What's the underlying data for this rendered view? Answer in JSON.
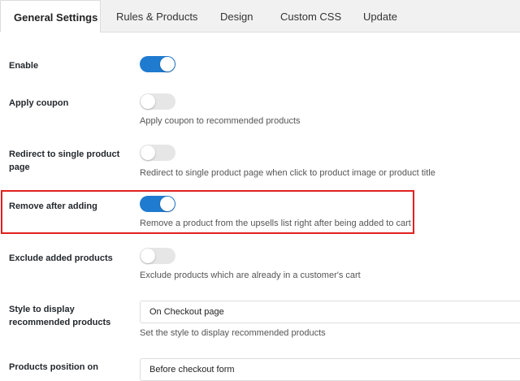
{
  "tabs": [
    {
      "label": "General Settings",
      "active": true
    },
    {
      "label": "Rules & Products",
      "active": false
    },
    {
      "label": "Design",
      "active": false
    },
    {
      "label": "Custom CSS",
      "active": false
    },
    {
      "label": "Update",
      "active": false
    }
  ],
  "settings": {
    "enable": {
      "label": "Enable",
      "checked": true
    },
    "apply_coupon": {
      "label": "Apply coupon",
      "checked": false,
      "description": "Apply coupon to recommended products"
    },
    "redirect": {
      "label_line1": "Redirect to single product",
      "label_line2": "page",
      "checked": false,
      "description": "Redirect to single product page when click to product image or product title"
    },
    "remove_after_adding": {
      "label": "Remove after adding",
      "checked": true,
      "description": "Remove a product from the upsells list right after being added to cart"
    },
    "exclude_added": {
      "label": "Exclude added products",
      "checked": false,
      "description": "Exclude products which are already in a customer's cart"
    },
    "style_display": {
      "label_line1": "Style to display",
      "label_line2": "recommended products",
      "value": "On Checkout page",
      "description": "Set the style to display recommended products"
    },
    "products_position": {
      "label_line1": "Products position on",
      "value": "Before checkout form"
    }
  },
  "colors": {
    "toggle_on": "#1f7bd0",
    "toggle_off": "#e6e6e6",
    "highlight": "#e0201e"
  }
}
